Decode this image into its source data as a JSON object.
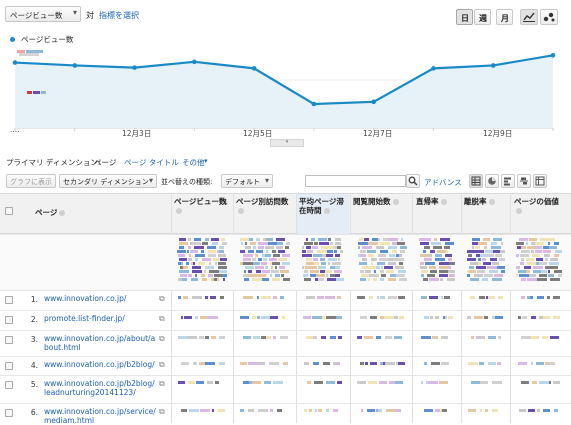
{
  "toolbar": {
    "metric_select": "ページビュー数",
    "vs_label": "対",
    "select_metric_link": "指標を選択",
    "period_buttons": [
      "日",
      "週",
      "月"
    ]
  },
  "chart": {
    "legend_label": "ページビュー数",
    "legend_color": "#1a89c7"
  },
  "chart_data": {
    "type": "area",
    "x": [
      "12月1日",
      "12月2日",
      "12月3日",
      "12月4日",
      "12月5日",
      "12月6日",
      "12月7日",
      "12月8日",
      "12月9日",
      "12月10日"
    ],
    "x_tick_labels": [
      "....",
      "12月3日",
      "12月5日",
      "12月7日",
      "12月9日"
    ],
    "series": [
      {
        "name": "ページビュー数",
        "values": [
          0.9,
          0.86,
          0.83,
          0.91,
          0.82,
          0.33,
          0.36,
          0.82,
          0.86,
          1.0
        ]
      }
    ],
    "ylim": [
      0,
      1.1
    ],
    "grid": true,
    "line_color": "#1a89c7",
    "fill_color": "#e6f1f8"
  },
  "dimension_bar": {
    "label": "プライマリ ディメンション:",
    "current": "ページ",
    "page_title_link": "ページ タイトル",
    "other_link": "その他"
  },
  "controls": {
    "plot_rows": "グラフに表示",
    "secondary_dimension": "セカンダリ ディメンション",
    "sort_type_label": "並べ替えの種類:",
    "sort_default": "デフォルト",
    "advanced": "アドバンス"
  },
  "table": {
    "headers": {
      "page": "ページ",
      "pageviews": "ページビュー数",
      "unique_pageviews": "ページ別訪問数",
      "avg_time": "平均ページ滞在時間",
      "entrances": "閲覧開始数",
      "bounce_rate": "直帰率",
      "exit_rate": "離脱率",
      "page_value": "ページの価値"
    },
    "rows": [
      {
        "num": "1.",
        "url": "www.innovation.co.jp/"
      },
      {
        "num": "2.",
        "url": "promote.list-finder.jp/"
      },
      {
        "num": "3.",
        "url": "www.innovation.co.jp/about/about.html"
      },
      {
        "num": "4.",
        "url": "www.innovation.co.jp/b2blog/"
      },
      {
        "num": "5.",
        "url": "www.innovation.co.jp/b2blog/leadnurturing20141123/"
      },
      {
        "num": "6.",
        "url": "www.innovation.co.jp/service/mediam.html"
      }
    ]
  }
}
